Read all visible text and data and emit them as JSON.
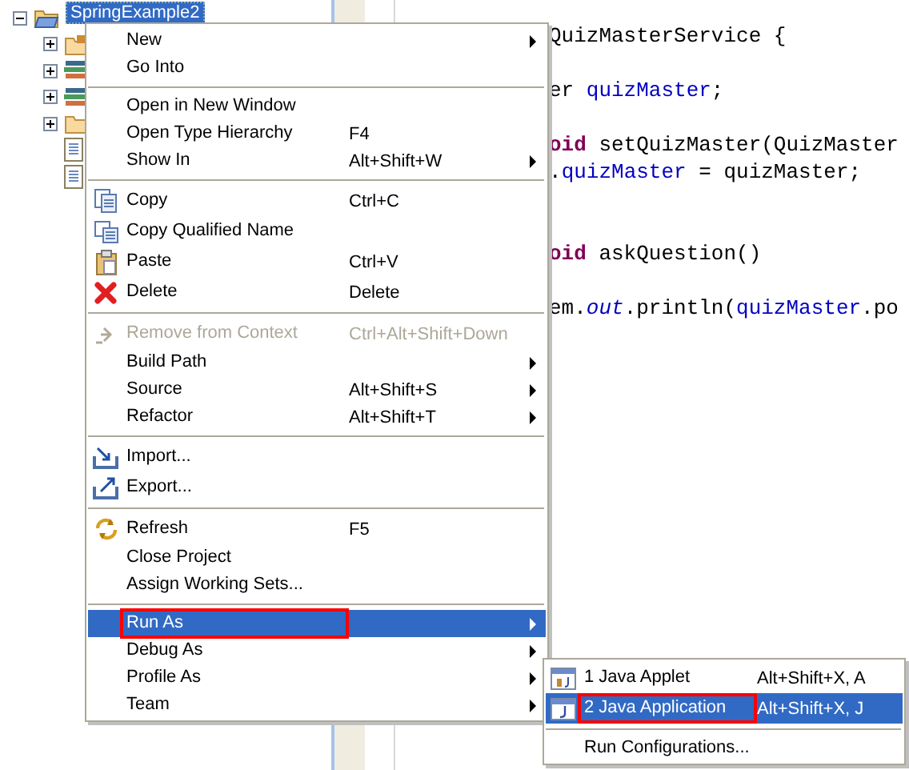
{
  "tree": {
    "label": "SpringExample2",
    "expanded": true,
    "selected": true,
    "kind": "project",
    "children": [
      {
        "kind": "package-folder",
        "expanded": false
      },
      {
        "kind": "library",
        "expanded": false
      },
      {
        "kind": "library",
        "expanded": false
      },
      {
        "kind": "folder",
        "expanded": false
      },
      {
        "kind": "file"
      },
      {
        "kind": "file"
      }
    ]
  },
  "editor": {
    "lines": [
      {
        "kind": "code",
        "segments": [
          {
            "text": "QuizMasterService {",
            "kind": "plain"
          }
        ]
      },
      {
        "kind": "blank"
      },
      {
        "kind": "code",
        "segments": [
          {
            "text": "er ",
            "kind": "plain"
          },
          {
            "text": "quizMaster",
            "kind": "field"
          },
          {
            "text": ";",
            "kind": "plain"
          }
        ]
      },
      {
        "kind": "blank"
      },
      {
        "kind": "code",
        "segments": [
          {
            "text": "oid",
            "kind": "keyword"
          },
          {
            "text": " setQuizMaster(QuizMaster",
            "kind": "plain"
          }
        ]
      },
      {
        "kind": "code",
        "segments": [
          {
            "text": ".",
            "kind": "plain"
          },
          {
            "text": "quizMaster",
            "kind": "field"
          },
          {
            "text": " = quizMaster;",
            "kind": "plain"
          }
        ]
      },
      {
        "kind": "blank"
      },
      {
        "kind": "blank"
      },
      {
        "kind": "code",
        "segments": [
          {
            "text": "oid",
            "kind": "keyword"
          },
          {
            "text": " askQuestion()",
            "kind": "plain"
          }
        ]
      },
      {
        "kind": "blank"
      },
      {
        "kind": "code",
        "segments": [
          {
            "text": "em.",
            "kind": "plain"
          },
          {
            "text": "out",
            "kind": "static"
          },
          {
            "text": ".println(",
            "kind": "plain"
          },
          {
            "text": "quizMaster",
            "kind": "field"
          },
          {
            "text": ".po",
            "kind": "plain"
          }
        ]
      }
    ]
  },
  "context_menu": {
    "items": [
      {
        "kind": "plain",
        "label": "New",
        "submenu": true,
        "disabled": false,
        "selected": false,
        "outlined": false
      },
      {
        "kind": "plain",
        "label": "Go Into",
        "submenu": false,
        "disabled": false,
        "selected": false,
        "outlined": false
      },
      {
        "kind": "separator"
      },
      {
        "kind": "plain",
        "label": "Open in New Window",
        "submenu": false,
        "disabled": false,
        "selected": false,
        "outlined": false
      },
      {
        "kind": "plain",
        "label": "Open Type Hierarchy",
        "shortcut": "F4",
        "submenu": false,
        "disabled": false,
        "selected": false,
        "outlined": false
      },
      {
        "kind": "plain",
        "label": "Show In",
        "shortcut": "Alt+Shift+W",
        "submenu": true,
        "disabled": false,
        "selected": false,
        "outlined": false
      },
      {
        "kind": "separator"
      },
      {
        "kind": "copy",
        "label": "Copy",
        "shortcut": "Ctrl+C",
        "submenu": false,
        "disabled": false,
        "selected": false,
        "outlined": false
      },
      {
        "kind": "copyname",
        "label": "Copy Qualified Name",
        "submenu": false,
        "disabled": false,
        "selected": false,
        "outlined": false
      },
      {
        "kind": "paste",
        "label": "Paste",
        "shortcut": "Ctrl+V",
        "submenu": false,
        "disabled": false,
        "selected": false,
        "outlined": false
      },
      {
        "kind": "delete",
        "label": "Delete",
        "shortcut": "Delete",
        "submenu": false,
        "disabled": false,
        "selected": false,
        "outlined": false
      },
      {
        "kind": "separator"
      },
      {
        "kind": "remove",
        "label": "Remove from Context",
        "shortcut": "Ctrl+Alt+Shift+Down",
        "submenu": false,
        "disabled": true,
        "selected": false,
        "outlined": false
      },
      {
        "kind": "plain",
        "label": "Build Path",
        "submenu": true,
        "disabled": false,
        "selected": false,
        "outlined": false
      },
      {
        "kind": "plain",
        "label": "Source",
        "shortcut": "Alt+Shift+S",
        "submenu": true,
        "disabled": false,
        "selected": false,
        "outlined": false
      },
      {
        "kind": "plain",
        "label": "Refactor",
        "shortcut": "Alt+Shift+T",
        "submenu": true,
        "disabled": false,
        "selected": false,
        "outlined": false
      },
      {
        "kind": "separator"
      },
      {
        "kind": "import",
        "label": "Import...",
        "submenu": false,
        "disabled": false,
        "selected": false,
        "outlined": false
      },
      {
        "kind": "export",
        "label": "Export...",
        "submenu": false,
        "disabled": false,
        "selected": false,
        "outlined": false
      },
      {
        "kind": "separator"
      },
      {
        "kind": "refresh",
        "label": "Refresh",
        "shortcut": "F5",
        "submenu": false,
        "disabled": false,
        "selected": false,
        "outlined": false
      },
      {
        "kind": "plain",
        "label": "Close Project",
        "submenu": false,
        "disabled": false,
        "selected": false,
        "outlined": false
      },
      {
        "kind": "plain",
        "label": "Assign Working Sets...",
        "submenu": false,
        "disabled": false,
        "selected": false,
        "outlined": false
      },
      {
        "kind": "separator"
      },
      {
        "kind": "plain",
        "label": "Run As",
        "submenu": true,
        "disabled": false,
        "selected": true,
        "outlined": true
      },
      {
        "kind": "plain",
        "label": "Debug As",
        "submenu": true,
        "disabled": false,
        "selected": false,
        "outlined": false
      },
      {
        "kind": "plain",
        "label": "Profile As",
        "submenu": true,
        "disabled": false,
        "selected": false,
        "outlined": false
      },
      {
        "kind": "plain",
        "label": "Team",
        "submenu": true,
        "disabled": false,
        "selected": false,
        "outlined": false
      }
    ]
  },
  "run_as_submenu": {
    "items": [
      {
        "kind": "applet",
        "label": "1 Java Applet",
        "shortcut": "Alt+Shift+X, A",
        "selected": false,
        "outlined": false
      },
      {
        "kind": "application",
        "label": "2 Java Application",
        "shortcut": "Alt+Shift+X, J",
        "selected": true,
        "outlined": true
      },
      {
        "kind": "separator"
      },
      {
        "kind": "plain",
        "label": "Run Configurations...",
        "selected": false,
        "outlined": false
      }
    ]
  }
}
